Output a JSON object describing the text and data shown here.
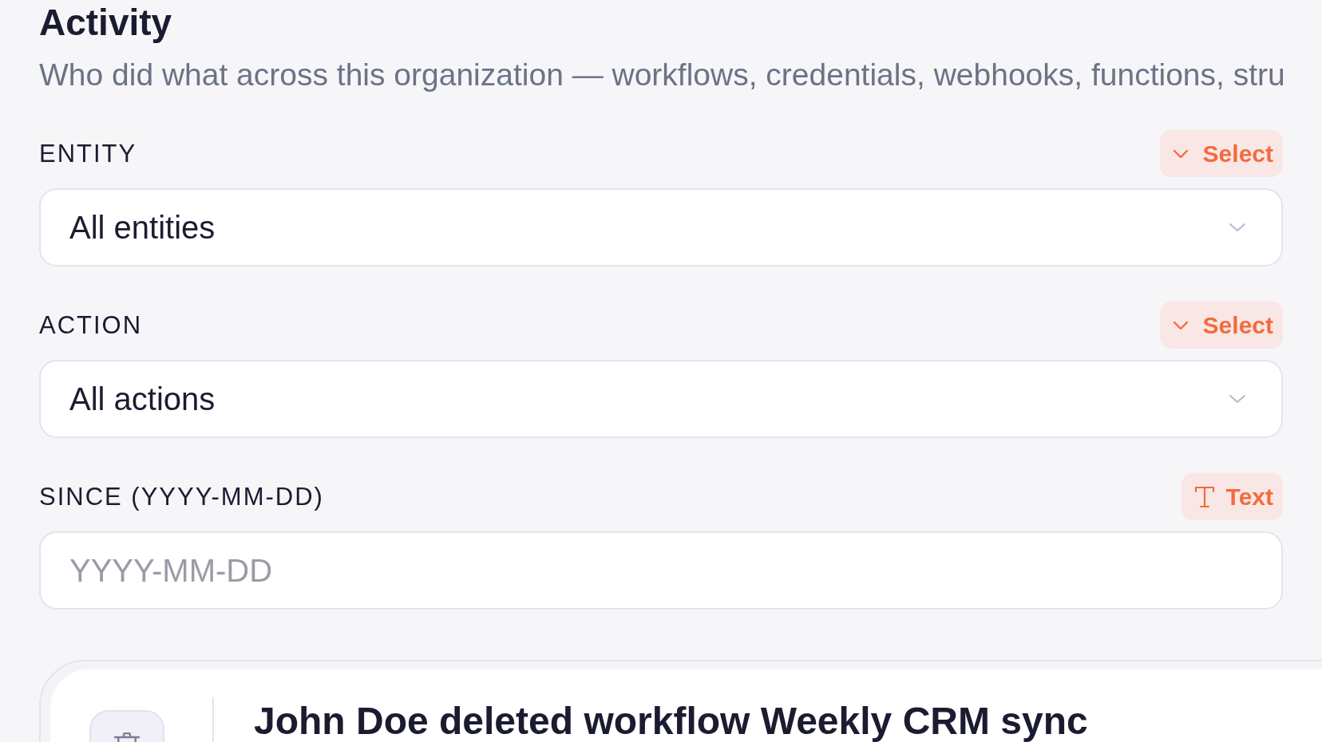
{
  "page": {
    "title": "Activity",
    "description": "Who did what across this organization — workflows, credentials, webhooks, functions, stru"
  },
  "filters": [
    {
      "label": "ENTITY",
      "kind": "select",
      "type_badge": "Select",
      "value": "All entities"
    },
    {
      "label": "ACTION",
      "kind": "select",
      "type_badge": "Select",
      "value": "All actions"
    },
    {
      "label": "SINCE (YYYY-MM-DD)",
      "kind": "text",
      "type_badge": "Text",
      "placeholder": "YYYY-MM-DD"
    }
  ],
  "events": [
    {
      "title": "John Doe deleted workflow Weekly CRM sync"
    }
  ]
}
